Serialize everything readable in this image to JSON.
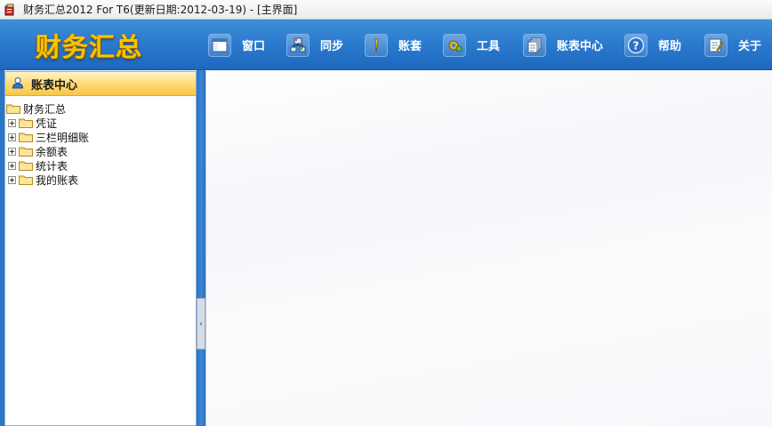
{
  "window": {
    "title": "财务汇总2012 For T6(更新日期:2012-03-19) - [主界面]"
  },
  "toolbar": {
    "logo": "财务汇总",
    "items": [
      {
        "label": "窗口",
        "icon": "window-icon"
      },
      {
        "label": "同步",
        "icon": "sync-icon"
      },
      {
        "label": "账套",
        "icon": "account-set-icon"
      },
      {
        "label": "工具",
        "icon": "tools-icon"
      },
      {
        "label": "账表中心",
        "icon": "report-center-icon"
      },
      {
        "label": "帮助",
        "icon": "help-icon"
      },
      {
        "label": "关于",
        "icon": "about-icon"
      }
    ]
  },
  "left_panel": {
    "title": "账表中心",
    "tree": {
      "root": "财务汇总",
      "children": [
        {
          "label": "凭证"
        },
        {
          "label": "三栏明细账"
        },
        {
          "label": "余额表"
        },
        {
          "label": "统计表"
        },
        {
          "label": "我的账表"
        }
      ]
    }
  },
  "splitter": {
    "arrow": "‹"
  },
  "colors": {
    "toolbar_blue": "#2c7bcf",
    "logo_gold": "#f6c400",
    "panel_header_yellow": "#ffd96f"
  }
}
